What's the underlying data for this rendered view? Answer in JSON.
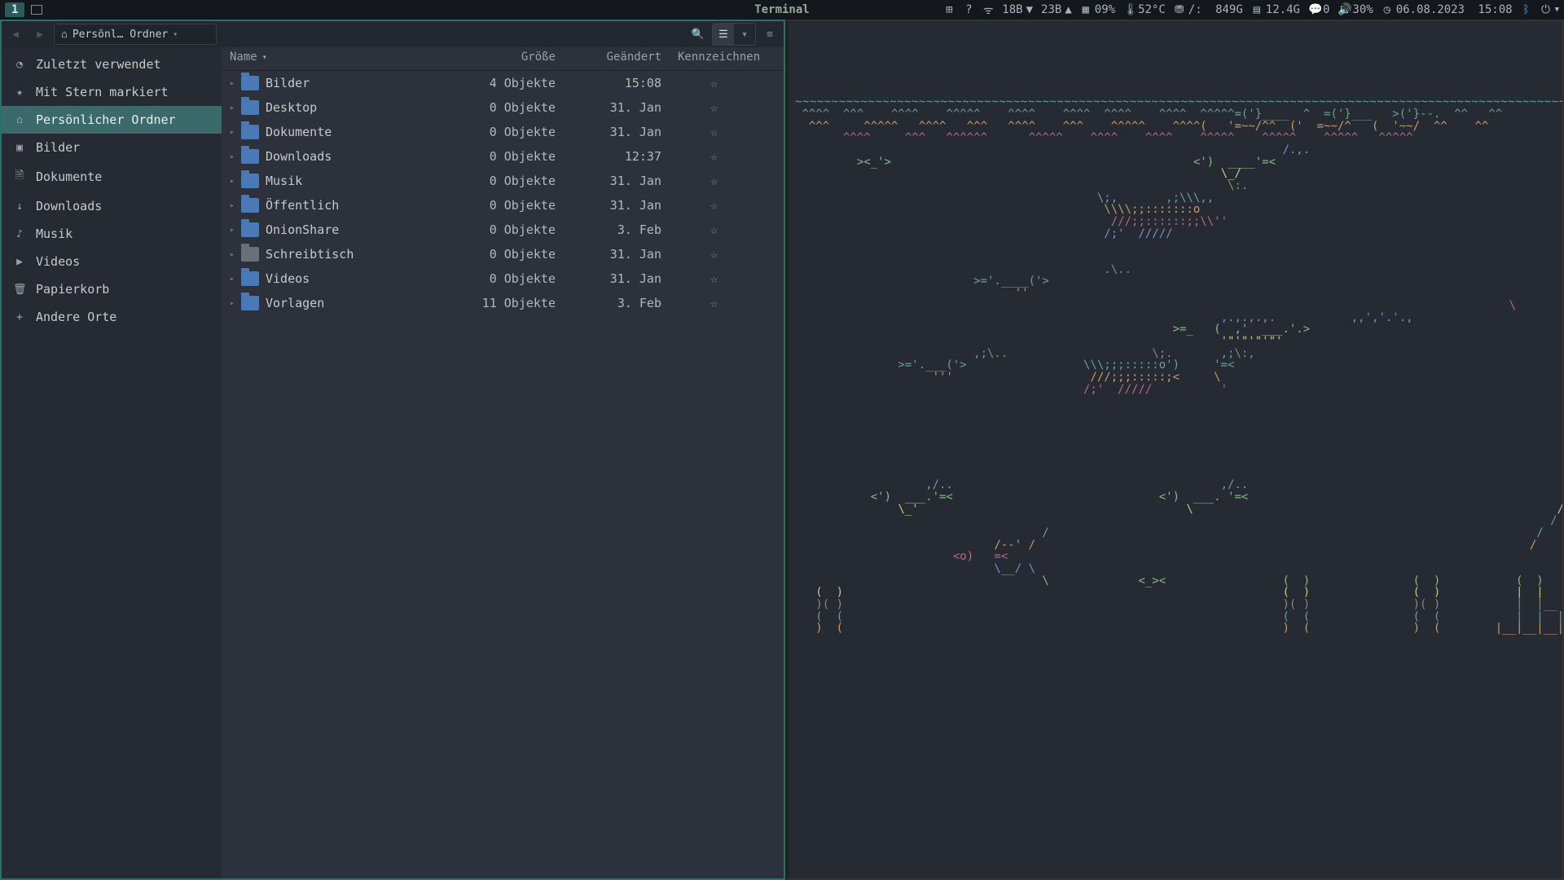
{
  "topbar": {
    "workspace": "1",
    "center_label": "Terminal",
    "net_down": "18B",
    "net_down_arrow": "▼",
    "net_up": "23B",
    "net_up_arrow": "▲",
    "cpu": "09%",
    "temp": "52°C",
    "disk_root": "/:",
    "disk_root_val": "849G",
    "ram": "12.4G",
    "notif": "0",
    "vol": "30%",
    "date": "06.08.2023",
    "time": "15:08"
  },
  "toolbar": {
    "path_label": "Persönl… Ordner"
  },
  "sidebar": {
    "items": [
      {
        "label": "Zuletzt verwendet",
        "icon": "◔",
        "active": false
      },
      {
        "label": "Mit Stern markiert",
        "icon": "★",
        "active": false
      },
      {
        "label": "Persönlicher Ordner",
        "icon": "⌂",
        "active": true
      },
      {
        "label": "Bilder",
        "icon": "▣",
        "active": false
      },
      {
        "label": "Dokumente",
        "icon": "🗎",
        "active": false
      },
      {
        "label": "Downloads",
        "icon": "↓",
        "active": false
      },
      {
        "label": "Musik",
        "icon": "♪",
        "active": false
      },
      {
        "label": "Videos",
        "icon": "▶",
        "active": false
      },
      {
        "label": "Papierkorb",
        "icon": "🗑",
        "active": false
      },
      {
        "label": "Andere Orte",
        "icon": "+",
        "active": false
      }
    ]
  },
  "columns": {
    "name": "Name",
    "size": "Größe",
    "modified": "Geändert",
    "star": "Kennzeichnen"
  },
  "files": [
    {
      "name": "Bilder",
      "size": "4 Objekte",
      "mod": "15:08",
      "icon": "folder"
    },
    {
      "name": "Desktop",
      "size": "0 Objekte",
      "mod": "31. Jan",
      "icon": "folder"
    },
    {
      "name": "Dokumente",
      "size": "0 Objekte",
      "mod": "31. Jan",
      "icon": "folder"
    },
    {
      "name": "Downloads",
      "size": "0 Objekte",
      "mod": "12:37",
      "icon": "folder"
    },
    {
      "name": "Musik",
      "size": "0 Objekte",
      "mod": "31. Jan",
      "icon": "music"
    },
    {
      "name": "Öffentlich",
      "size": "0 Objekte",
      "mod": "31. Jan",
      "icon": "folder"
    },
    {
      "name": "OnionShare",
      "size": "0 Objekte",
      "mod": "3. Feb",
      "icon": "folder"
    },
    {
      "name": "Schreibtisch",
      "size": "0 Objekte",
      "mod": "31. Jan",
      "icon": "gray"
    },
    {
      "name": "Videos",
      "size": "0 Objekte",
      "mod": "31. Jan",
      "icon": "folder"
    },
    {
      "name": "Vorlagen",
      "size": "11 Objekte",
      "mod": "3. Feb",
      "icon": "folder"
    }
  ],
  "terminal": {
    "lines": [
      "",
      "",
      "",
      "",
      "",
      "",
      "~~~~~~~~~~~~~~~~~~~~~~~~~~~~~~~~~~~~~~~~~~~~~~~~~~~~~~~~~~~~~~~~~~~~~~~~~~~~~~~~~~~~~~~~~~~~~~~~~~~~~~~~~~~~  ~~~   ~~~~   ~~~~~~~~~~~~~",
      " ^^^^  ^^^    ^^^^    ^^^^^    ^^^^    ^^^^  ^^^^    ^^^^  ^^^^^=('}____  ^  =('}___   >('}--.  ^^   ^^",
      "  ^^^     ^^^^^   ^^^^   ^^^   ^^^^    ^^^    ^^^^^    ^^^^(   '=~~/^^  ('  =~~/^   (  '~~/  ^^    ^^",
      "       ^^^^     ^^^   ^^^^^^      ^^^^^    ^^^^    ^^^^    ^^^^^    ^^^^^    ^^^^^   ^^^^^",
      "                                                                       /.,.",
      "         ><_'>                                            <')  ____'=<",
      "                                                              \\_/",
      "                                                               \\:.",
      "                                            \\;,       ,;\\\\\\,,",
      "                                             \\\\\\\\;;:::::::o",
      "                                              ///;;::::::;;\\\\''",
      "                                             /;'  /////",
      "",
      "",
      "                                             .\\..",
      "                          >='.____('>",
      "                                ''",
      "                                                                                                        \\",
      "                                                              ,.,.,.,.           ,,','.'.,",
      "                                                       >=_   (  ,'  ___.'.>",
      "                                                              '\"'\"'\"'\"'",
      "                          ,;\\..                     \\;.       ,;\\:,",
      "               >='.___('>                 \\\\\\;;;:::::o')     '=<",
      "                    '''                    ///;;;:::::;<     \\",
      "                                          /;'  /////          '",
      "",
      "",
      "",
      "",
      "",
      "",
      "",
      "                   ,/..                                       ,/..",
      "           <')  ___.'=<                              <')  ___. '=<                                              ~~",
      "               \\_'                                       \\                                                     /''\\",
      "                                                                                                              /    \\",
      "                                    /                                                                       /       \\",
      "                             /--' /                                                                        /         \\",
      "                       <o)   =<                                                                                       ",
      "                             \\__/ \\                                                                                       ",
      "                                    \\             <_><                 (  )               (  )           (  )",
      "   (  )                                                                (  )               (  )           |  |",
      "   )( )                                                                )( )               )( )           |  |__",
      "   (  (                                                                (  (               (  (           |  |  |",
      "   )  (                                                                )  (               )  (        |__|__|__|"
    ]
  }
}
